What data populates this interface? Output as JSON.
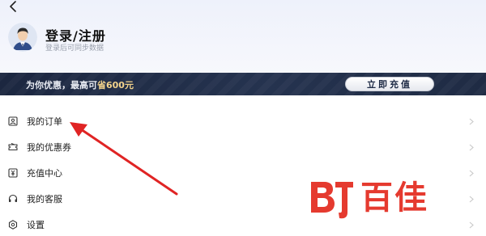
{
  "header": {
    "back_icon": "chevron-left-icon",
    "login_title": "登录/注册",
    "login_subtitle": "登录后可同步数据",
    "avatar_icon": "user-avatar-icon"
  },
  "vip_banner": {
    "text_prefix": "为你优惠，最高可",
    "text_highlight": "省600元",
    "button_label": "立即充值",
    "highlight_color": "#f3d38c"
  },
  "menu": {
    "items": [
      {
        "label": "我的订单",
        "icon": "order-icon"
      },
      {
        "label": "我的优惠券",
        "icon": "coupon-icon"
      },
      {
        "label": "充值中心",
        "icon": "yen-icon"
      },
      {
        "label": "我的客服",
        "icon": "headset-icon"
      },
      {
        "label": "设置",
        "icon": "settings-icon"
      }
    ]
  },
  "watermark": {
    "text": "百佳",
    "color": "#e53a2f"
  },
  "annotation": {
    "arrow_color": "#e02424"
  }
}
